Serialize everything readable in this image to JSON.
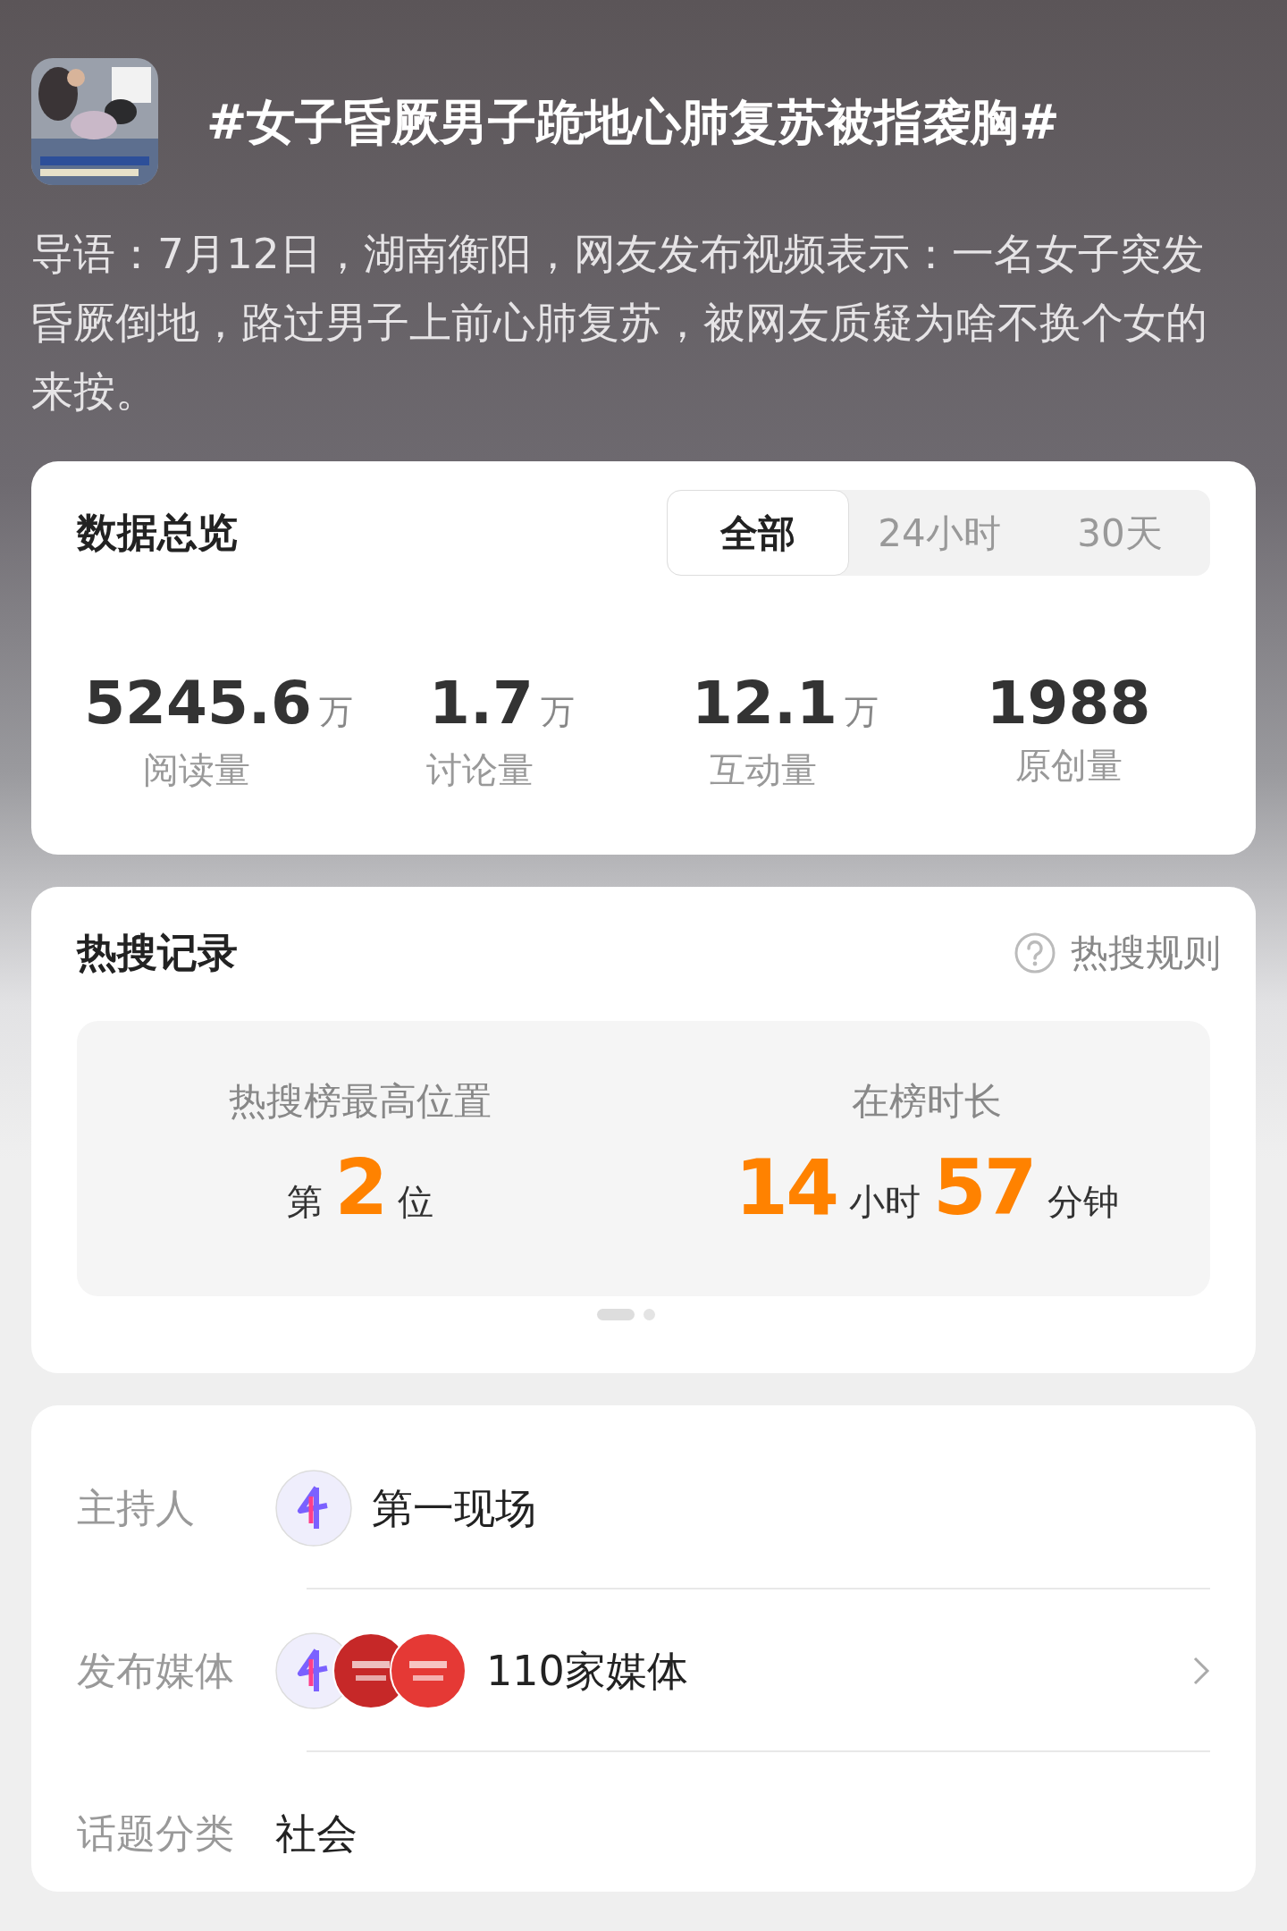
{
  "topic": {
    "title": "#女子昏厥男子跪地心肺复苏被指袭胸#",
    "intro": "导语：7月12日，湖南衡阳，网友发布视频表示：一名女子突发昏厥倒地，路过男子上前心肺复苏，被网友质疑为啥不换个女的来按。"
  },
  "overview": {
    "title": "数据总览",
    "tabs": [
      {
        "label": "全部",
        "selected": true
      },
      {
        "label": "24小时",
        "selected": false
      },
      {
        "label": "30天",
        "selected": false
      }
    ],
    "stats": [
      {
        "value": "5245.6",
        "unit": "万",
        "label": "阅读量"
      },
      {
        "value": "1.7",
        "unit": "万",
        "label": "讨论量"
      },
      {
        "value": "12.1",
        "unit": "万",
        "label": "互动量"
      },
      {
        "value": "1988",
        "label": "原创量"
      }
    ]
  },
  "hot_search": {
    "title": "热搜记录",
    "rules_link": "热搜规则",
    "items": [
      {
        "label": "热搜榜最高位置",
        "parts": [
          {
            "kind": "text",
            "text": "第"
          },
          {
            "kind": "number",
            "text": "2"
          },
          {
            "kind": "text",
            "text": "位"
          }
        ]
      },
      {
        "label": "在榜时长",
        "parts": [
          {
            "kind": "number",
            "text": "14"
          },
          {
            "kind": "text",
            "text": "小时"
          },
          {
            "kind": "number",
            "text": "57"
          },
          {
            "kind": "text",
            "text": "分钟"
          }
        ]
      }
    ],
    "pager": [
      {
        "selected": true
      },
      {
        "selected": false
      }
    ]
  },
  "info": [
    {
      "label": "主持人",
      "avatars": [
        {
          "color": "#7b61ff"
        }
      ],
      "value": "第一现场",
      "link": false
    },
    {
      "label": "发布媒体",
      "avatars": [
        {
          "color": "#7b61ff"
        },
        {
          "color": "#c62828"
        },
        {
          "color": "#e53935"
        }
      ],
      "value": "110家媒体",
      "link": true
    },
    {
      "label": "话题分类",
      "value": "社会",
      "link": false
    }
  ]
}
